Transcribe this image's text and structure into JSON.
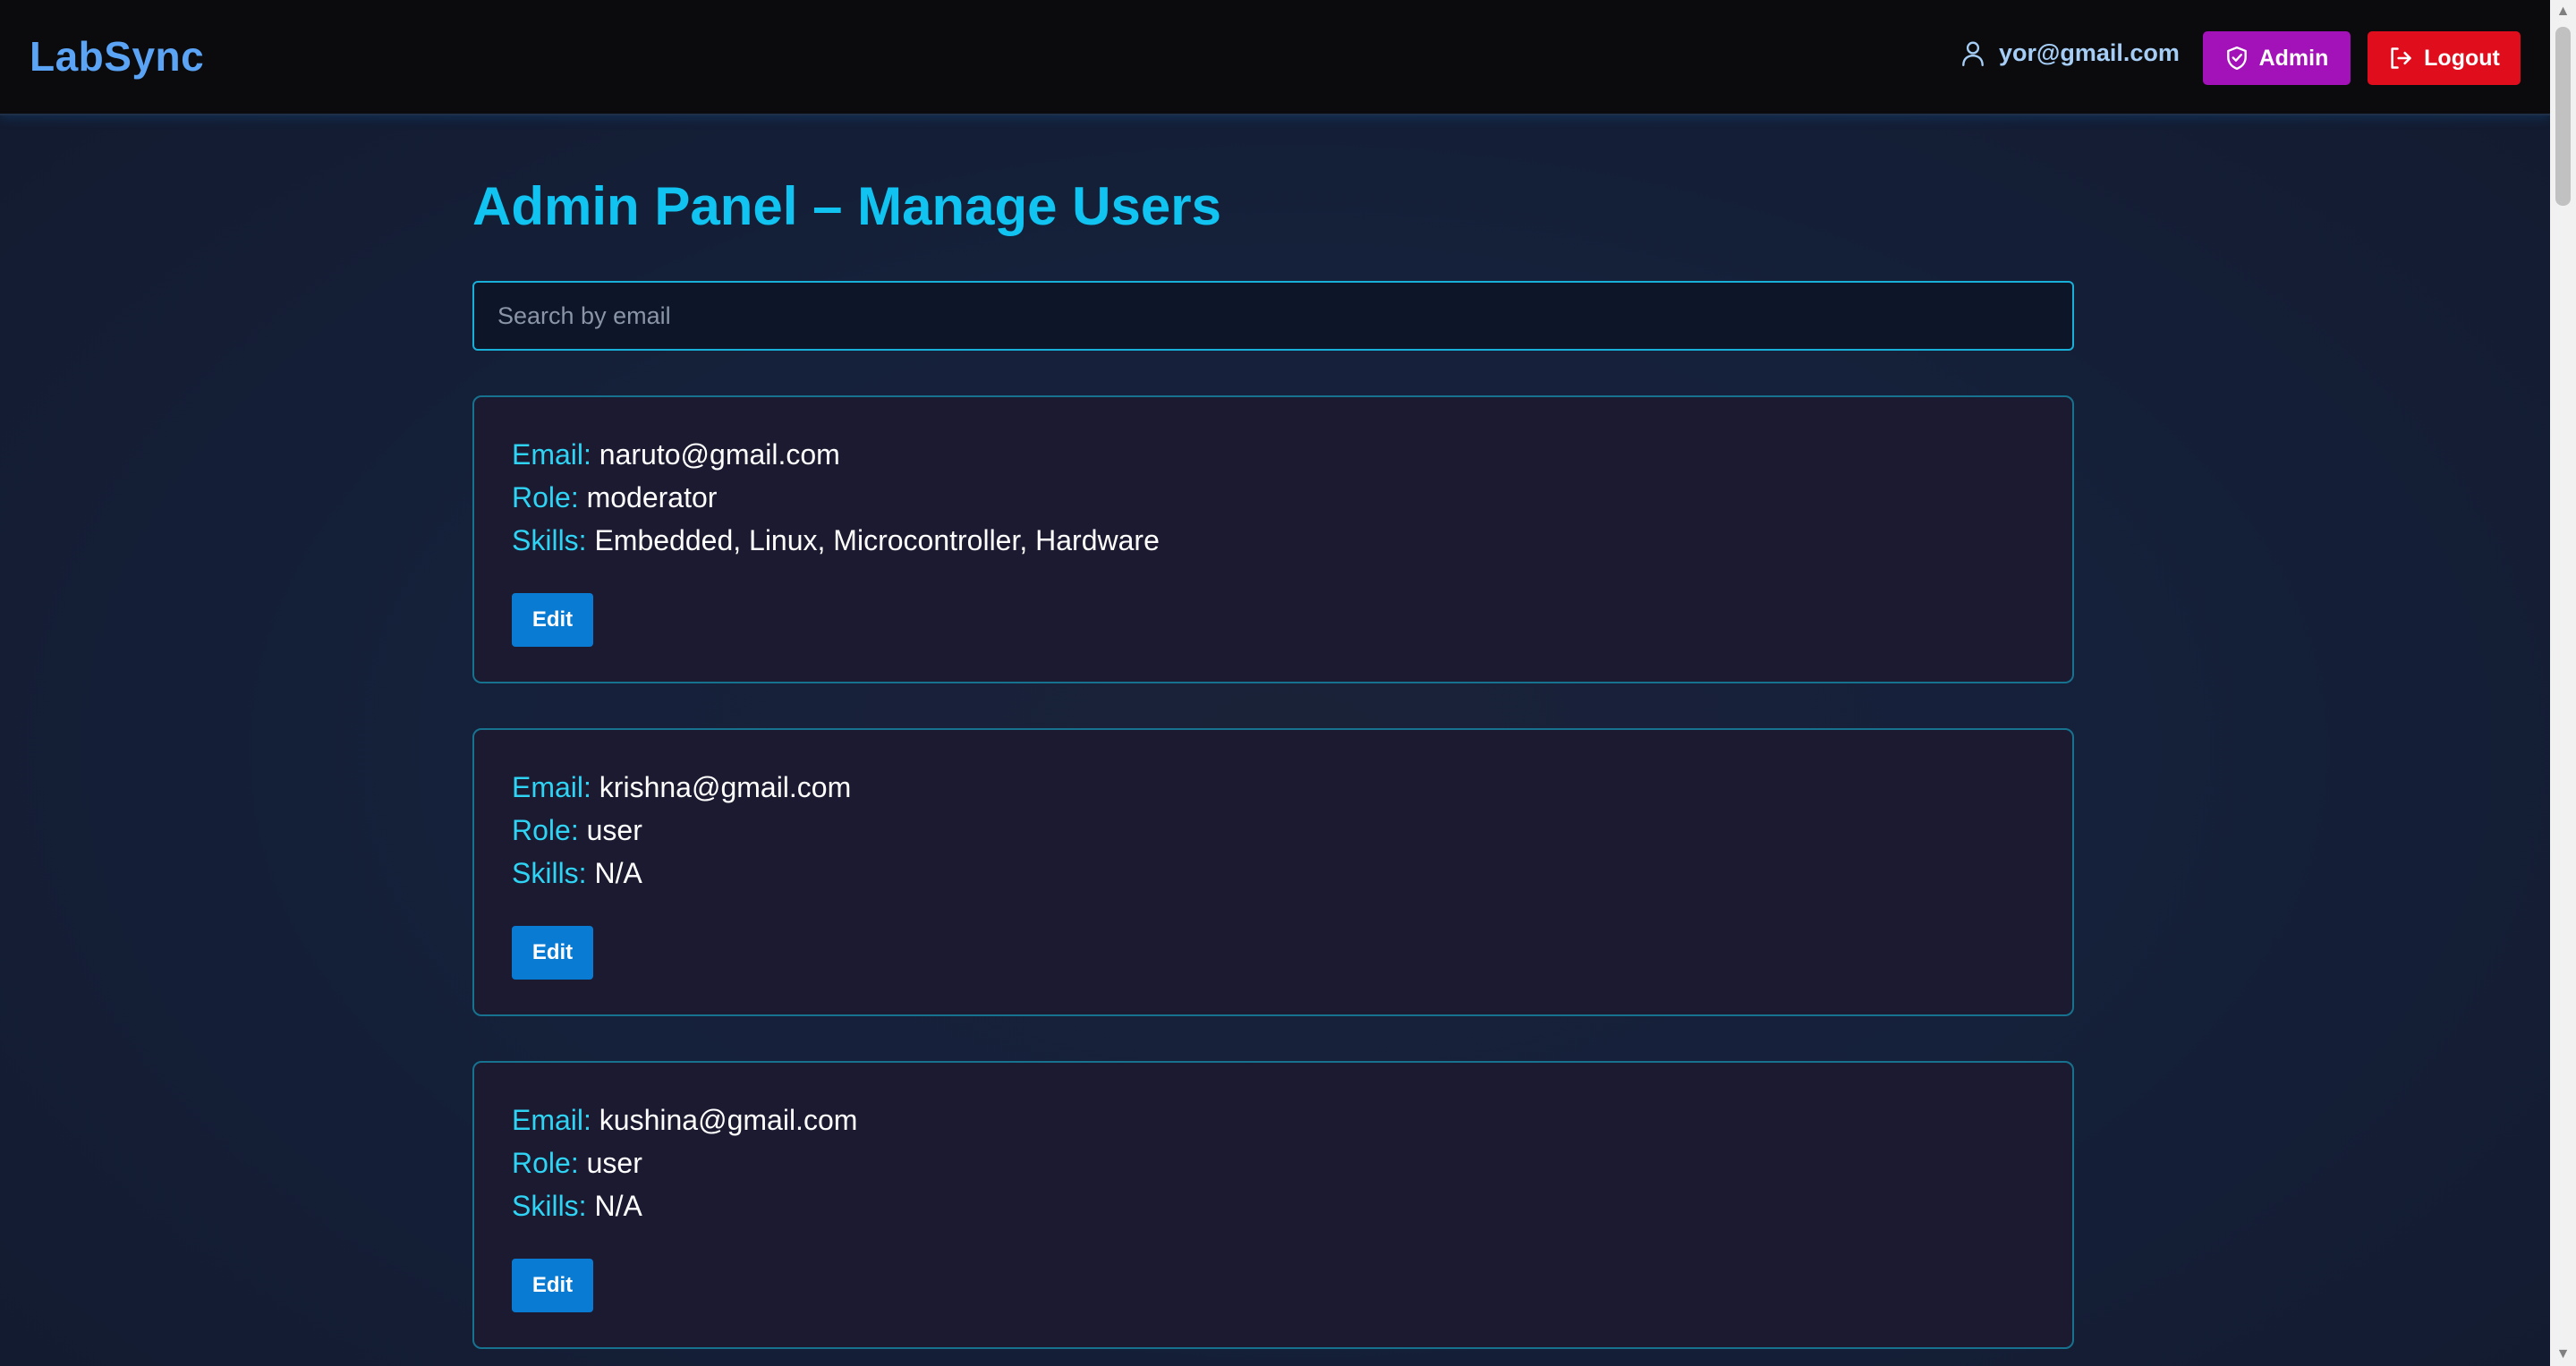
{
  "app": {
    "brand": "LabSync"
  },
  "navbar": {
    "user_email": "yor@gmail.com",
    "user_icon": "user-icon",
    "admin_label": "Admin",
    "admin_icon": "shield-icon",
    "logout_label": "Logout",
    "logout_icon": "logout-icon"
  },
  "page": {
    "title": "Admin Panel – Manage Users"
  },
  "search": {
    "placeholder": "Search by email",
    "value": ""
  },
  "labels": {
    "email": "Email:",
    "role": "Role:",
    "skills": "Skills:"
  },
  "users": [
    {
      "email": "naruto@gmail.com",
      "role": "moderator",
      "skills": "Embedded, Linux, Microcontroller, Hardware",
      "edit_label": "Edit"
    },
    {
      "email": "krishna@gmail.com",
      "role": "user",
      "skills": "N/A",
      "edit_label": "Edit"
    },
    {
      "email": "kushina@gmail.com",
      "role": "user",
      "skills": "N/A",
      "edit_label": "Edit"
    }
  ],
  "colors": {
    "brand": "#5aa3f5",
    "title": "#10c3f0",
    "admin_button": "#a311b8",
    "logout_button": "#e00d1c",
    "edit_button": "#0a7bd2",
    "field_label": "#2fd3f4"
  }
}
